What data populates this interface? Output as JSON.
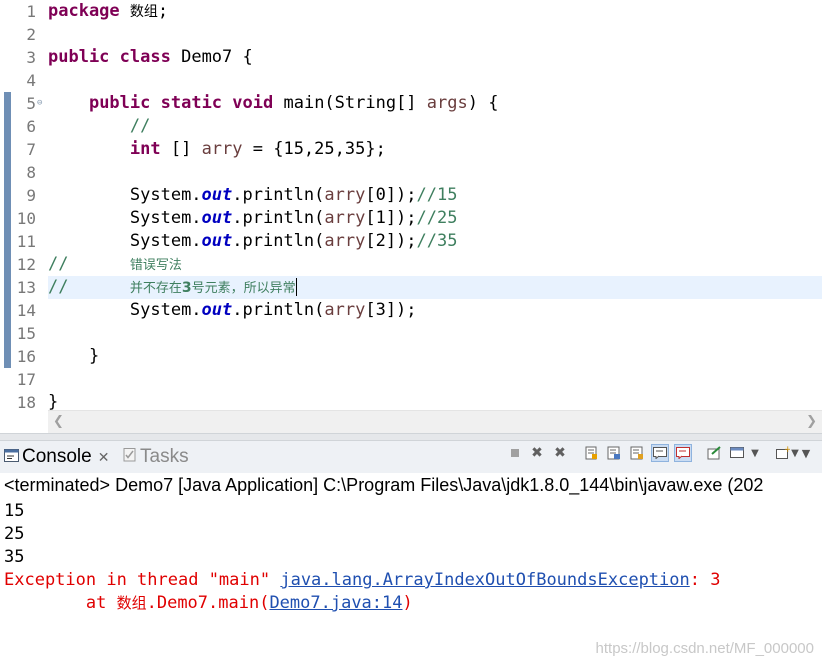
{
  "editor": {
    "line_numbers": [
      "1",
      "2",
      "3",
      "4",
      "5",
      "6",
      "7",
      "8",
      "9",
      "10",
      "11",
      "12",
      "13",
      "14",
      "15",
      "16",
      "17",
      "18"
    ],
    "lines": [
      {
        "kw": "package",
        "rest_cn": "数组",
        "tail": ";"
      },
      {},
      {
        "kw1": "public",
        "kw2": "class",
        "rest": " Demo7 {"
      },
      {},
      {
        "indent": "    ",
        "kw1": "public",
        "kw2": "static",
        "kw3": "void",
        "rest1": " main(String[] ",
        "var": "args",
        "rest2": ") {"
      },
      {
        "indent": "        ",
        "comment": "//"
      },
      {
        "indent": "        ",
        "kw": "int",
        "rest1": " [] ",
        "var": "arry",
        "rest2": " = {15,25,35};"
      },
      {},
      {
        "indent": "        ",
        "p1": "System.",
        "field": "out",
        "p2": ".println(",
        "var": "arry",
        "p3": "[0]);",
        "comment": "//15"
      },
      {
        "indent": "        ",
        "p1": "System.",
        "field": "out",
        "p2": ".println(",
        "var": "arry",
        "p3": "[1]);",
        "comment": "//25"
      },
      {
        "indent": "        ",
        "p1": "System.",
        "field": "out",
        "p2": ".println(",
        "var": "arry",
        "p3": "[2]);",
        "comment": "//35"
      },
      {
        "comment": "//",
        "gap": "      ",
        "comment_cn": "错误写法"
      },
      {
        "comment": "//",
        "gap": "      ",
        "comment_cn_a": "并不存在",
        "comment_num": "3",
        "comment_cn_b": "号元素，所以异常"
      },
      {
        "indent": "        ",
        "p1": "System.",
        "field": "out",
        "p2": ".println(",
        "var": "arry",
        "p3": "[3]);"
      },
      {},
      {
        "indent": "    ",
        "rest": "}"
      },
      {},
      {
        "rest": "}"
      }
    ]
  },
  "console": {
    "tabs": [
      {
        "label": "Console",
        "close": "✕",
        "icon": "console-icon"
      },
      {
        "label": "Tasks",
        "icon": "tasks-icon"
      }
    ],
    "toolbar_icons": [
      "terminate-icon",
      "remove-launch-icon",
      "remove-all-terminated-icon",
      "scroll-lock-icon",
      "word-wrap-icon",
      "clear-console-icon",
      "show-on-stdout-icon",
      "show-on-stderr-icon",
      "pin-console-icon",
      "display-selected-console-icon",
      "display-dropdown-icon",
      "open-console-icon",
      "open-dropdown-icon",
      "view-menu-icon"
    ],
    "header": "<terminated> Demo7 [Java Application] C:\\Program Files\\Java\\jdk1.8.0_144\\bin\\javaw.exe (202",
    "output": [
      "15",
      "25",
      "35"
    ],
    "exception_prefix": "Exception in thread \"main\" ",
    "exception_class": "java.lang.ArrayIndexOutOfBoundsException",
    "exception_suffix": ": 3",
    "trace_at": "        at ",
    "trace_pkg": "数组",
    "trace_method": ".Demo7.main(",
    "trace_link": "Demo7.java:14",
    "trace_end": ")"
  },
  "watermark": "https://blog.csdn.net/MF_000000",
  "colors": {
    "keyword": "#7f0055",
    "comment": "#3f7f5f",
    "field": "#0000c0",
    "variable": "#6a3e3e",
    "error": "#e00000",
    "link": "#1f4fb0"
  }
}
